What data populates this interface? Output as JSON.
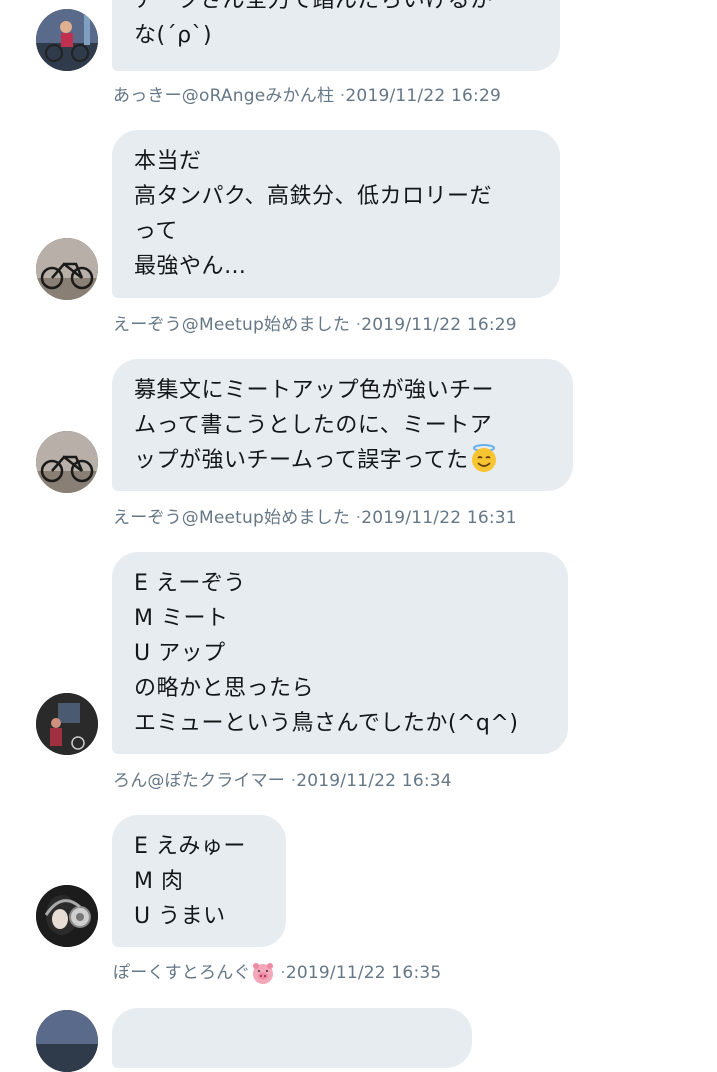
{
  "messages": [
    {
      "lines": [
        "アークさん全力で踏んだらいけるか",
        "な(´ρ`)"
      ],
      "author": "あっきー@oRAngeみかん柱",
      "time": "2019/11/22 16:29"
    },
    {
      "lines": [
        "本当だ",
        "高タンパク、高鉄分、低カロリーだ",
        "って",
        "最強やん…"
      ],
      "author": "えーぞう@Meetup始めました",
      "time": "2019/11/22 16:29"
    },
    {
      "lines": [
        "募集文にミートアップ色が強いチー",
        "ムって書こうとしたのに、ミートア",
        "ップが強いチームって誤字ってた"
      ],
      "emoji": "halo-smile-emoji",
      "author": "えーぞう@Meetup始めました",
      "time": "2019/11/22 16:31"
    },
    {
      "lines": [
        "E えーぞう",
        "M ミート",
        "U アップ",
        "の略かと思ったら",
        "エミューという鳥さんでしたか(^q^)"
      ],
      "author": "ろん@ぽたクライマー",
      "time": "2019/11/22 16:34"
    },
    {
      "lines": [
        "E えみゅー",
        "M 肉",
        "U うまい"
      ],
      "author": "ぽーくすとろんぐ",
      "author_emoji": "pig-face-emoji",
      "time": "2019/11/22 16:35"
    }
  ],
  "separator": "·"
}
